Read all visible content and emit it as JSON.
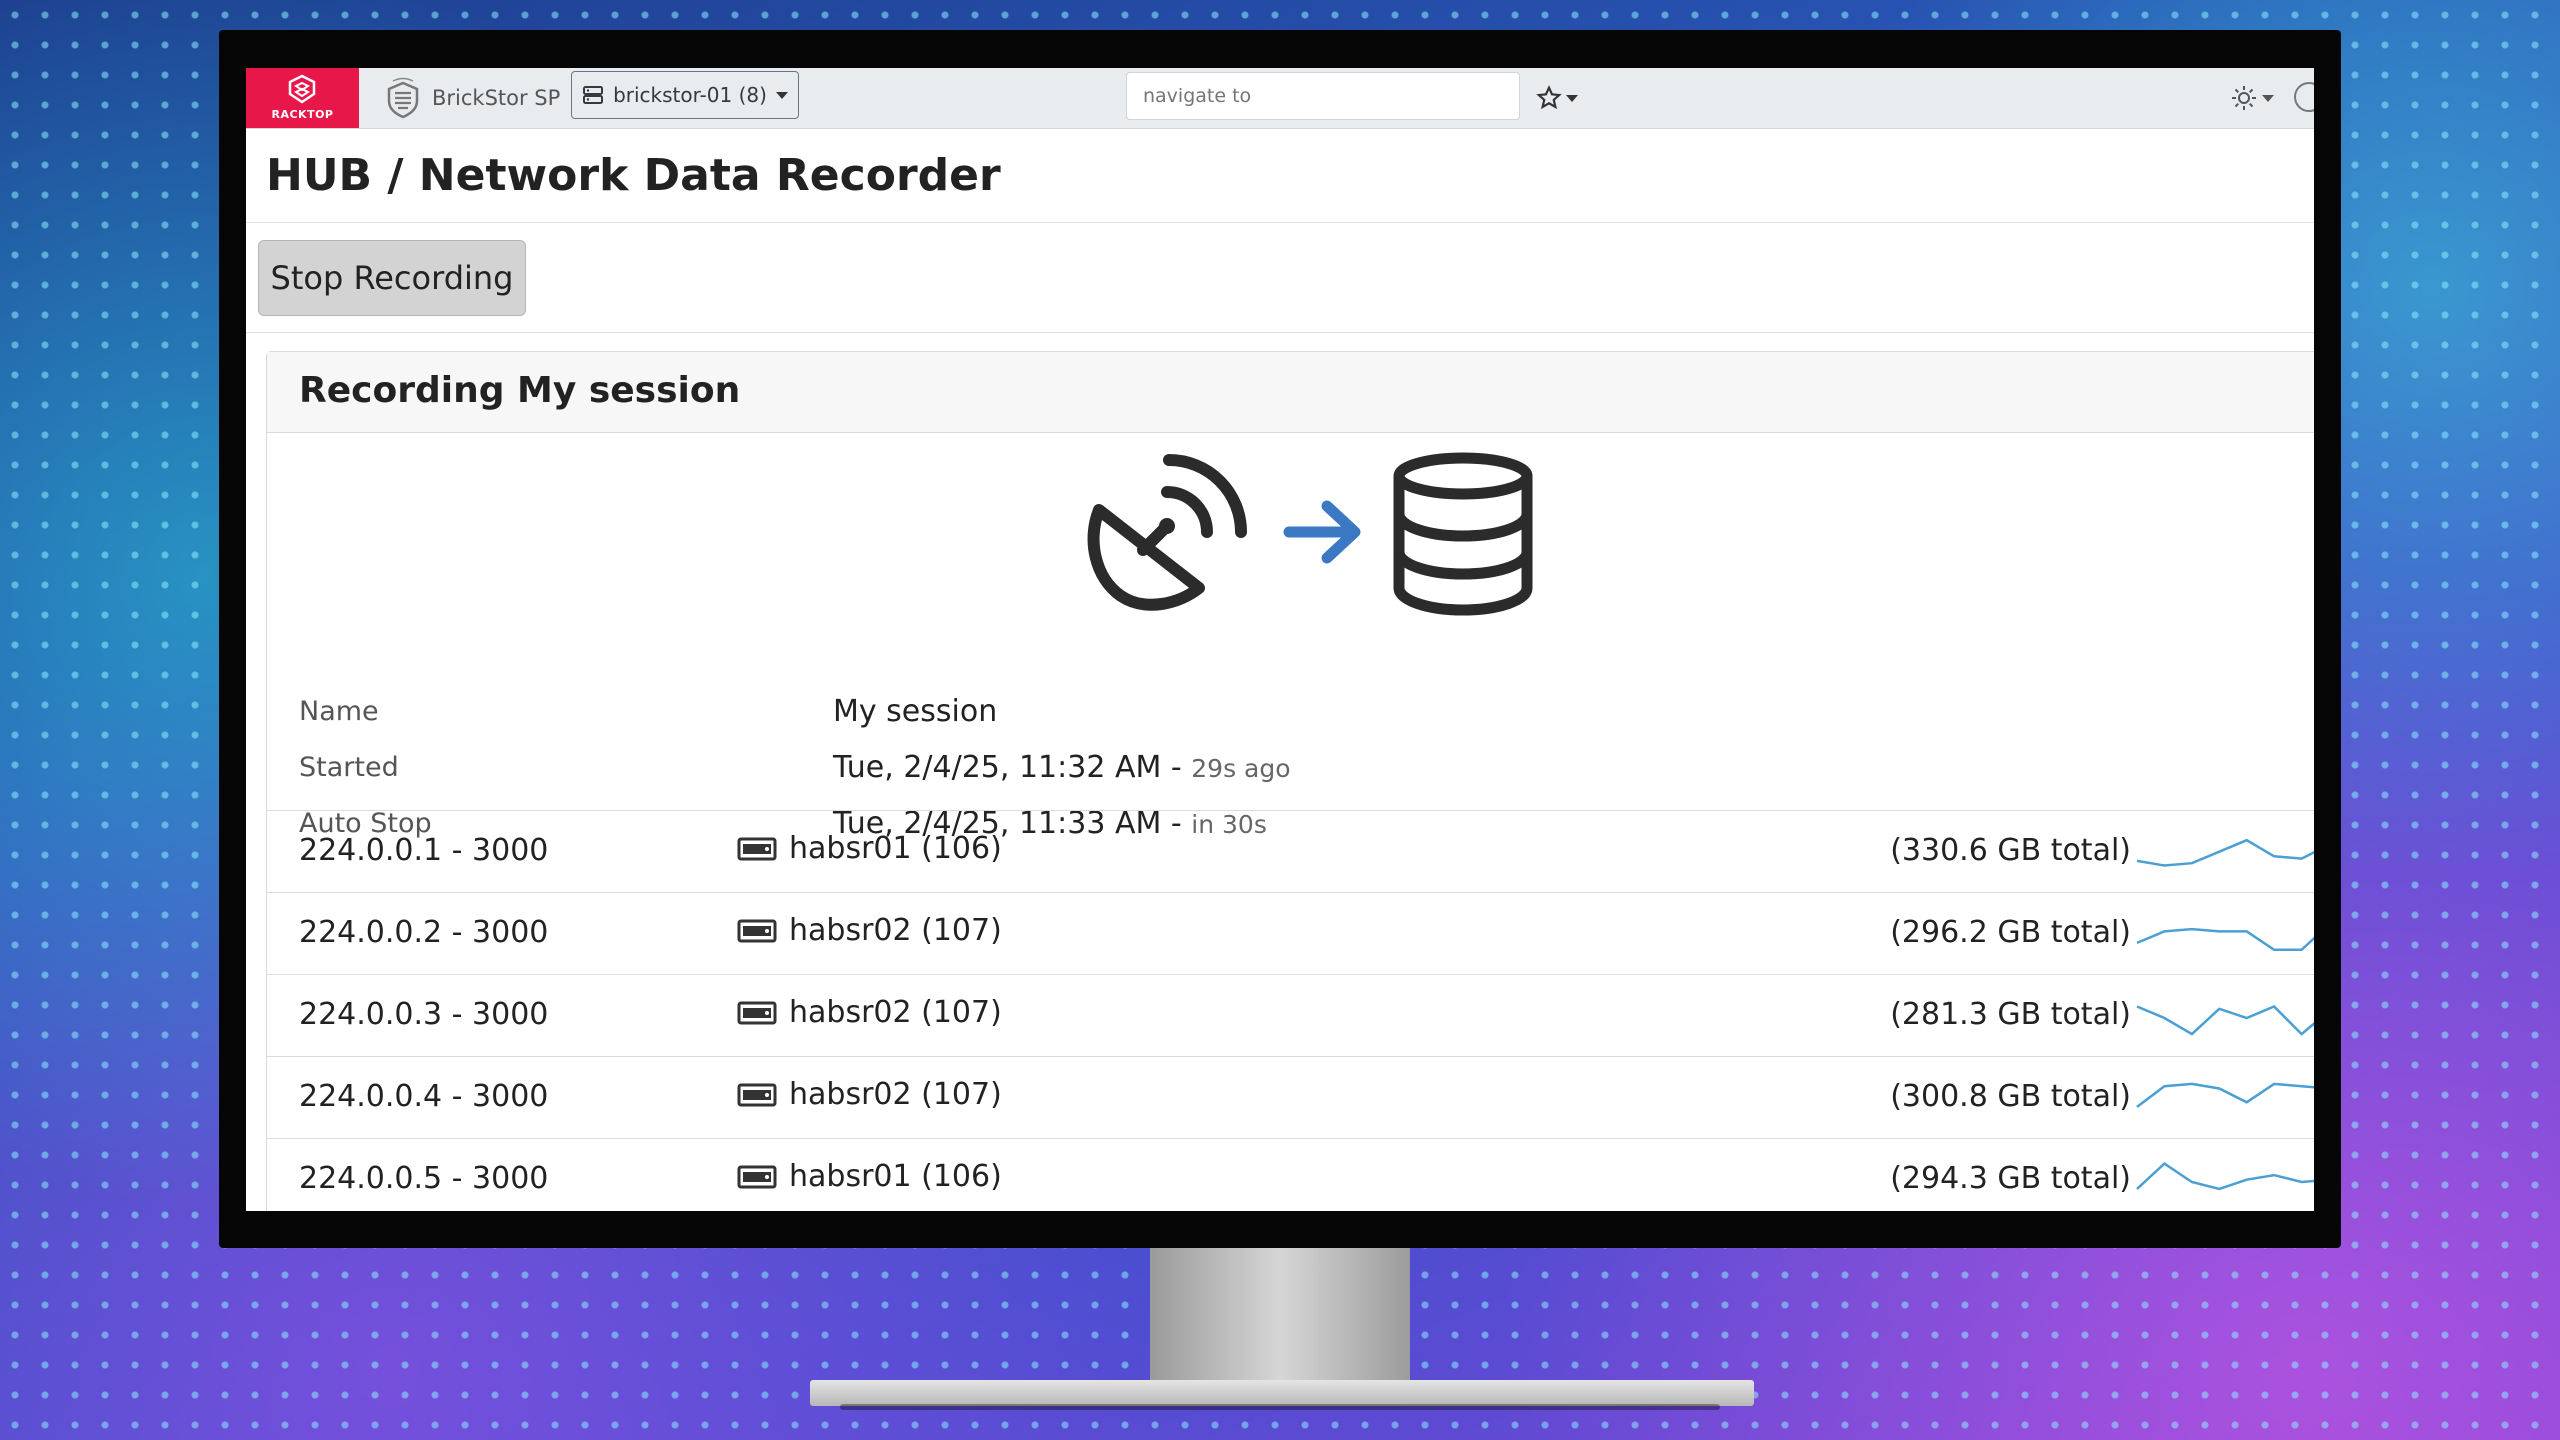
{
  "app": {
    "logo_text": "RACKTOP",
    "brand_name": "BrickStor SP",
    "node_selector": "brickstor-01 (8)",
    "navigate_placeholder": "navigate to"
  },
  "page": {
    "title": "HUB / Network Data Recorder",
    "stop_button": "Stop Recording"
  },
  "recording": {
    "header": "Recording My session",
    "fields": [
      {
        "label": "Name",
        "value": "My session",
        "suffix": ""
      },
      {
        "label": "Started",
        "value": "Tue, 2/4/25, 11:32 AM",
        "suffix": "29s ago"
      },
      {
        "label": "Auto Stop",
        "value": "Tue, 2/4/25, 11:33 AM",
        "suffix": "in 30s"
      }
    ],
    "separator": " - "
  },
  "streams": [
    {
      "address": "224.0.0.1 - 3000",
      "host": "habsr01 (106)",
      "total": "(330.6 GB total)",
      "trend": [
        0.35,
        0.25,
        0.3,
        0.55,
        0.8,
        0.45,
        0.4,
        0.7
      ]
    },
    {
      "address": "224.0.0.2 - 3000",
      "host": "habsr02 (107)",
      "total": "(296.2 GB total)",
      "trend": [
        0.35,
        0.6,
        0.65,
        0.6,
        0.6,
        0.2,
        0.2,
        0.75
      ]
    },
    {
      "address": "224.0.0.3 - 3000",
      "host": "habsr02 (107)",
      "total": "(281.3 GB total)",
      "trend": [
        0.75,
        0.5,
        0.15,
        0.7,
        0.5,
        0.75,
        0.15,
        0.65
      ]
    },
    {
      "address": "224.0.0.4 - 3000",
      "host": "habsr02 (107)",
      "total": "(300.8 GB total)",
      "trend": [
        0.35,
        0.8,
        0.85,
        0.75,
        0.45,
        0.85,
        0.8,
        0.75
      ]
    },
    {
      "address": "224.0.0.5 - 3000",
      "host": "habsr01 (106)",
      "total": "(294.3 GB total)",
      "trend": [
        0.35,
        0.9,
        0.5,
        0.35,
        0.55,
        0.65,
        0.5,
        0.55
      ]
    }
  ],
  "colors": {
    "brand_red": "#e8174a",
    "arrow_blue": "#3a78c4",
    "sparkline": "#4a9fd4"
  },
  "icons": {
    "transfer": [
      "satellite-dish-icon",
      "arrow-right-icon",
      "database-icon"
    ],
    "host": "server-icon"
  }
}
